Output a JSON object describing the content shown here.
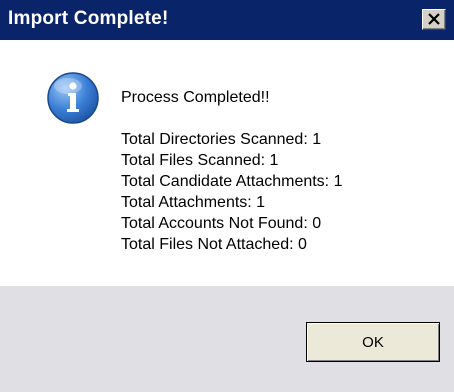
{
  "window": {
    "title": "Import Complete!",
    "close_icon": "close-icon"
  },
  "message": {
    "icon": "info-icon",
    "headline": "Process Completed!!",
    "stats": [
      "Total Directories Scanned: 1",
      "Total Files Scanned: 1",
      "Total Candidate Attachments: 1",
      "Total Attachments: 1",
      "Total Accounts Not Found: 0",
      "Total Files Not Attached: 0"
    ]
  },
  "buttons": {
    "ok_label": "OK"
  },
  "colors": {
    "titlebar": "#0a246a",
    "footer": "#e0dfe3",
    "info_icon": "#2f6fc9"
  }
}
